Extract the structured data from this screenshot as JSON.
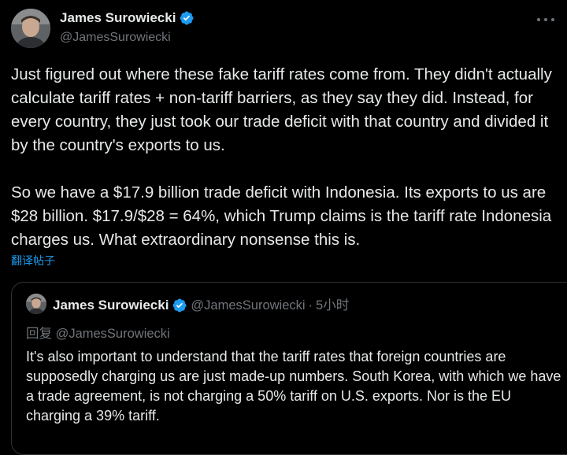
{
  "author": {
    "display_name": "James Surowiecki",
    "handle": "@JamesSurowiecki"
  },
  "tweet": {
    "paragraphs": [
      "Just figured out where these fake tariff rates come from. They didn't actually calculate tariff rates + non-tariff barriers, as they say they did. Instead, for every country, they just took our trade deficit with that country and divided it by the country's exports to us.",
      "So we have a $17.9 billion trade deficit with Indonesia. Its exports to us are $28 billion. $17.9/$28 = 64%, which Trump claims is the tariff rate Indonesia charges us. What extraordinary nonsense this is."
    ],
    "translate_label": "翻译帖子"
  },
  "quoted_tweet": {
    "display_name": "James Surowiecki",
    "handle": "@JamesSurowiecki",
    "separator": "·",
    "time": "5小时",
    "reply_to": "回复 @JamesSurowiecki",
    "text": "It's also important to understand that the tariff rates that foreign countries are supposedly charging us are just made-up numbers. South Korea, with which we have a trade agreement, is not charging a 50% tariff on U.S. exports. Nor is the EU charging a 39% tariff."
  },
  "icons": {
    "verified": "verified-badge-icon",
    "more": "more-options-icon"
  },
  "colors": {
    "background": "#000000",
    "text": "#e7e9ea",
    "secondary": "#71767b",
    "accent": "#1d9bf0",
    "border": "#2f3336"
  }
}
